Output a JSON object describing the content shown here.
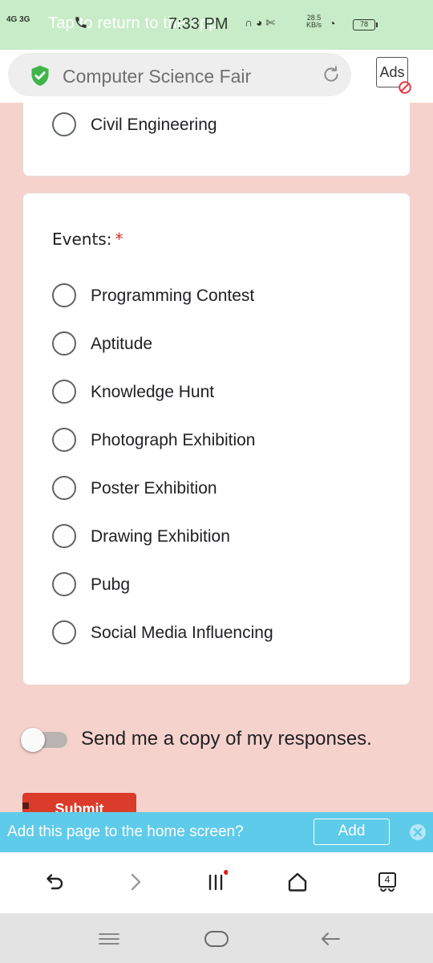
{
  "status_bar": {
    "signal": "4G 3G",
    "ghost_text": "Tap to return to the app",
    "time": "7:33 PM",
    "icons": "∩ ◕ ✄",
    "speed_value": "28.5",
    "speed_unit": "KB/s",
    "battery": "78"
  },
  "address_bar": {
    "title": "Computer Science Fair",
    "ads_label": "Ads"
  },
  "form": {
    "previous_option": "Civil Engineering",
    "events_question": "Events:",
    "required_mark": "*",
    "events_options": [
      "Programming Contest",
      "Aptitude",
      "Knowledge Hunt",
      "Photograph Exhibition",
      "Poster Exhibition",
      "Drawing Exhibition",
      "Pubg",
      "Social Media Influencing"
    ],
    "copy_label": "Send me a copy of my responses.",
    "submit_label": "Submit"
  },
  "banner": {
    "text": "Add this page to the home screen?",
    "add_label": "Add"
  },
  "toolbar": {
    "tabs_count": "4"
  },
  "colors": {
    "page_bg": "#f6d2cd",
    "status_bar": "#c9ecc8",
    "banner": "#5ecbea",
    "submit": "#db3b2a",
    "required": "#d93025"
  }
}
